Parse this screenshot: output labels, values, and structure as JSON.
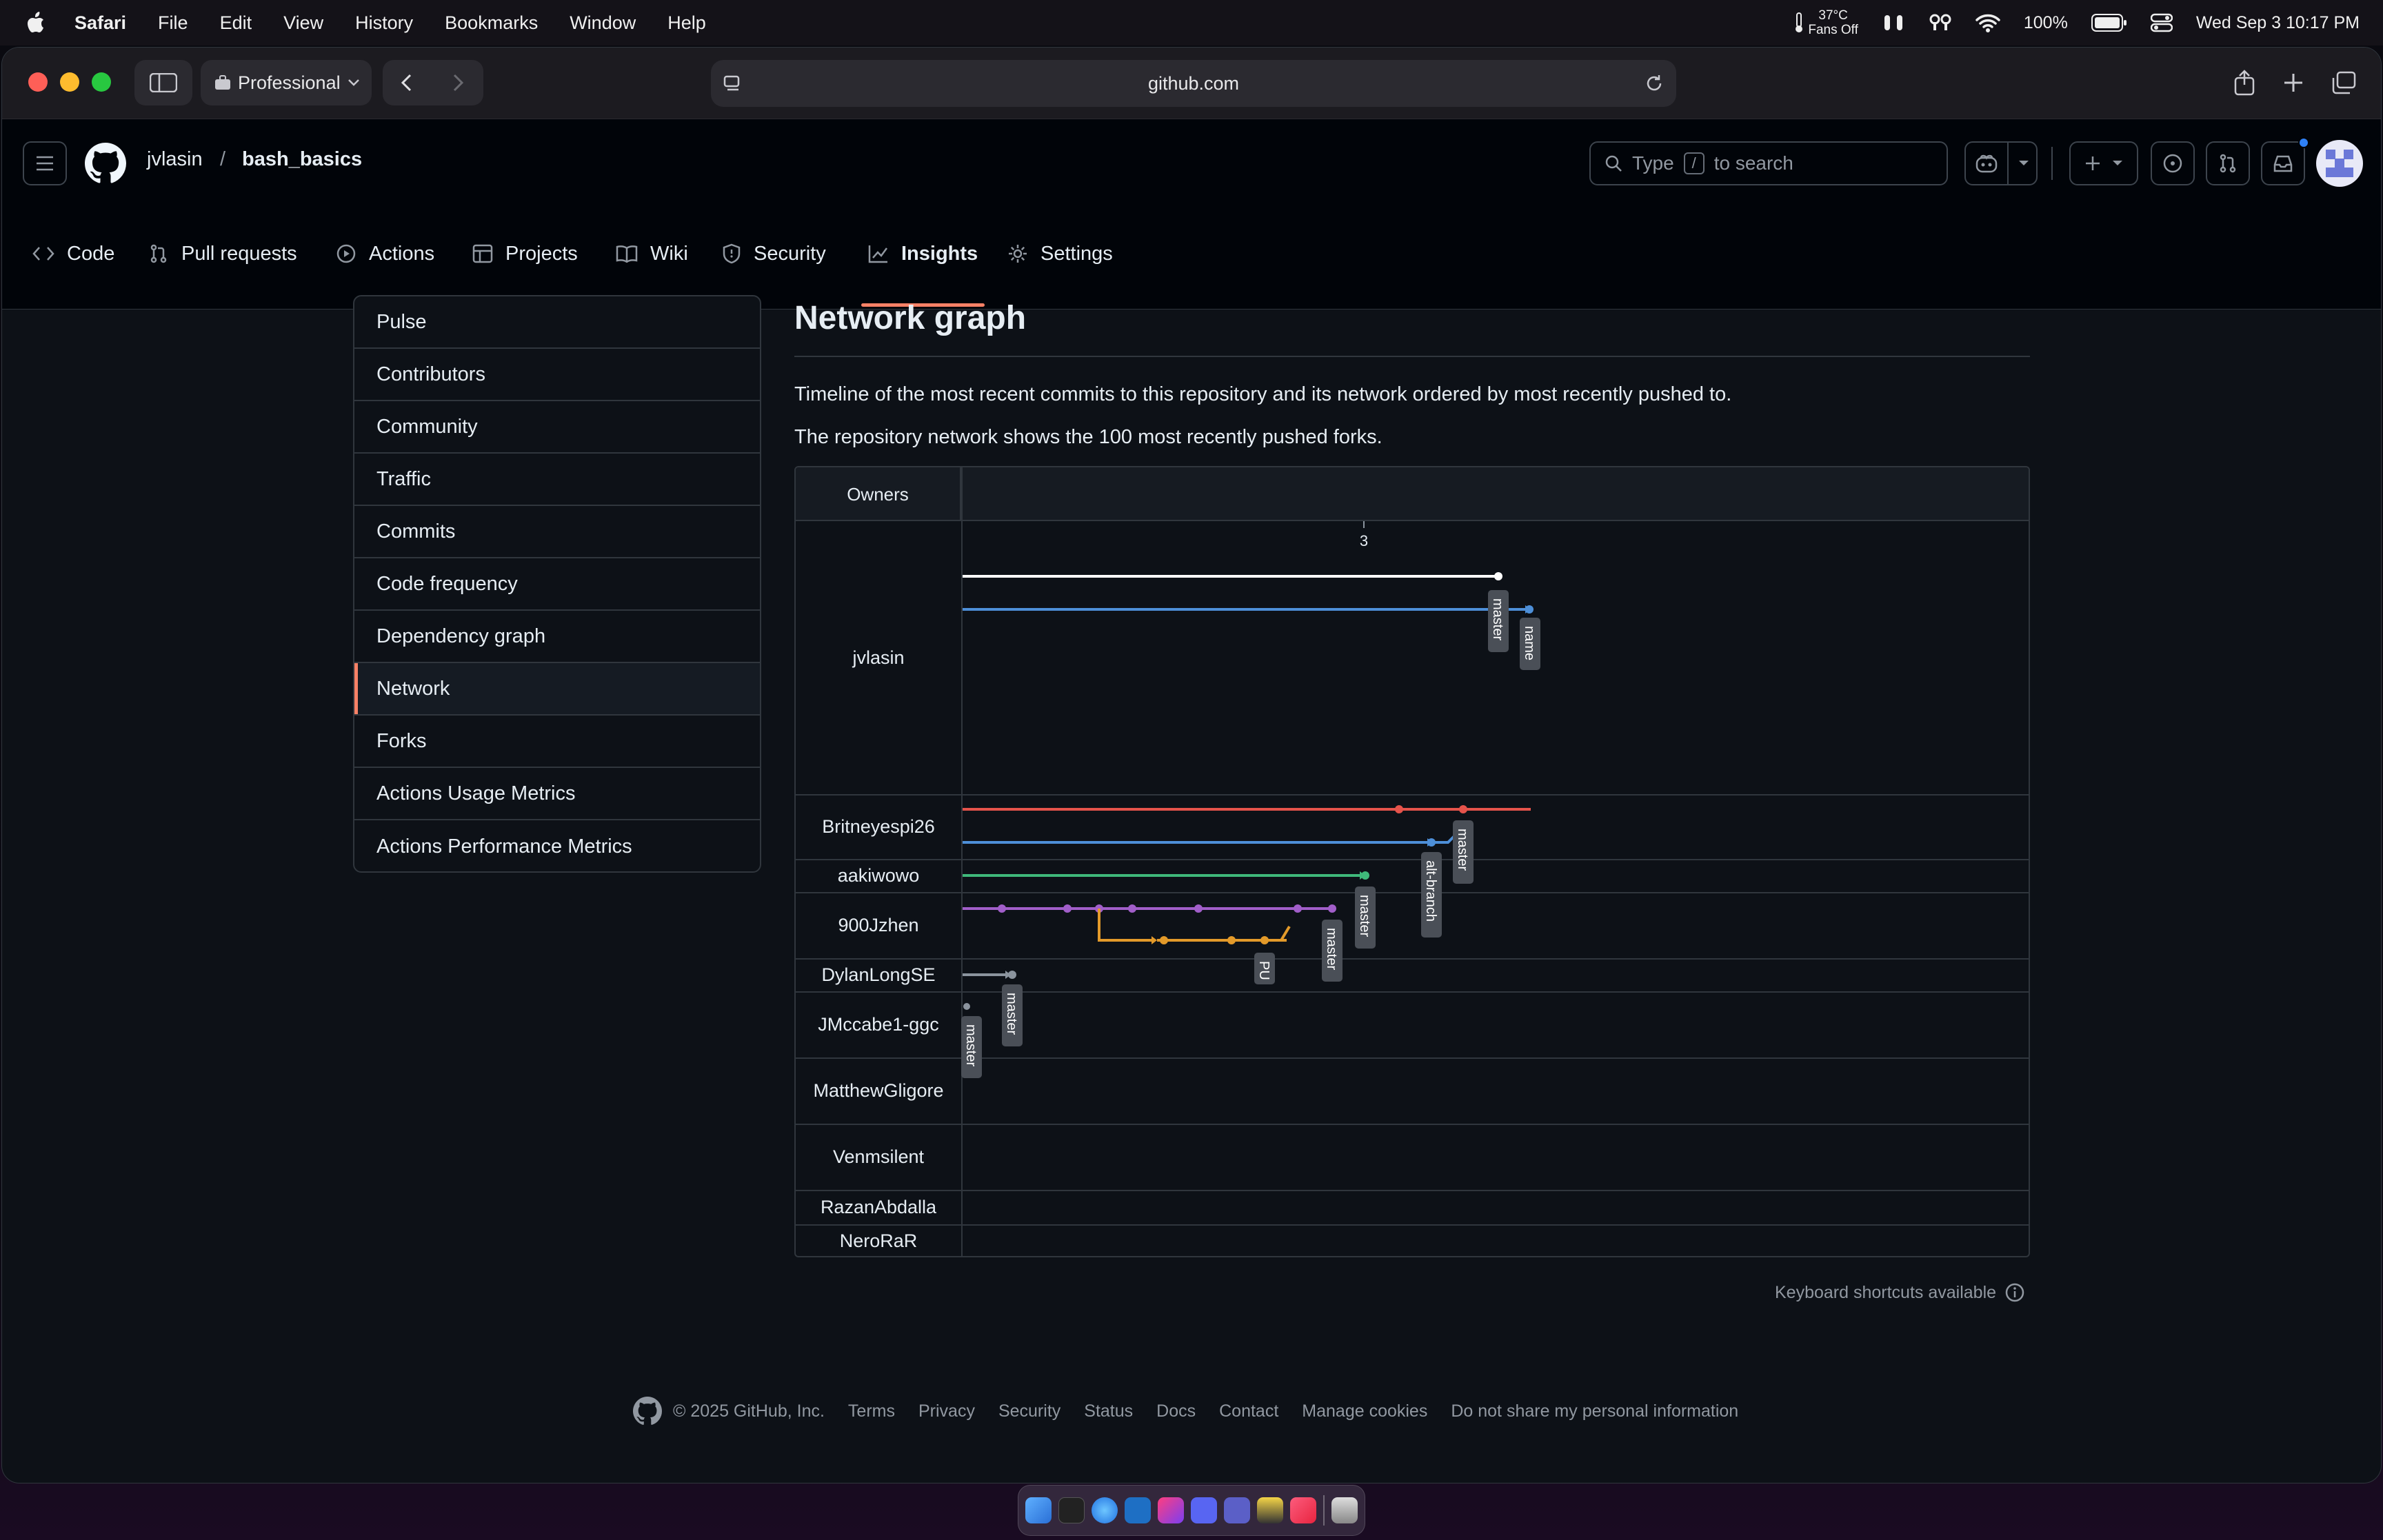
{
  "menubar": {
    "app": "Safari",
    "items": [
      "File",
      "Edit",
      "View",
      "History",
      "Bookmarks",
      "Window",
      "Help"
    ],
    "temp": "37°C",
    "fans": "Fans Off",
    "battery": "100%",
    "datetime": "Wed Sep 3  10:17 PM"
  },
  "browser": {
    "profile": "Professional",
    "url": "github.com"
  },
  "header": {
    "owner": "jvlasin",
    "separator": "/",
    "repo": "bash_basics",
    "search_prefix": "Type",
    "search_key": "/",
    "search_suffix": "to search"
  },
  "tabs": [
    "Code",
    "Pull requests",
    "Actions",
    "Projects",
    "Wiki",
    "Security",
    "Insights",
    "Settings"
  ],
  "sidebar": [
    "Pulse",
    "Contributors",
    "Community",
    "Traffic",
    "Commits",
    "Code frequency",
    "Dependency graph",
    "Network",
    "Forks",
    "Actions Usage Metrics",
    "Actions Performance Metrics"
  ],
  "main": {
    "title": "Network graph",
    "desc1": "Timeline of the most recent commits to this repository and its network ordered by most recently pushed to.",
    "desc2": "The repository network shows the 100 most recently pushed forks."
  },
  "graph": {
    "owners_header": "Owners",
    "date_label": "3",
    "owners": [
      "jvlasin",
      "Britneyespi26",
      "aakiwowo",
      "900Jzhen",
      "DylanLongSE",
      "JMccabe1-ggc",
      "MatthewGligore",
      "Venmsilent",
      "RazanAbdalla",
      "NeroRaR"
    ],
    "branch_labels": [
      "master",
      "name",
      "master",
      "alt-branch",
      "master",
      "master",
      "PU",
      "master",
      "master"
    ],
    "colors": {
      "white": "#ffffff",
      "blue": "#4d8fd8",
      "red": "#e5534b",
      "green": "#3fb97a",
      "purple": "#a15ec9",
      "orange": "#e39a2a",
      "gray": "#8b949e"
    }
  },
  "hint": "Keyboard shortcuts available",
  "footer": {
    "copyright": "© 2025 GitHub, Inc.",
    "links": [
      "Terms",
      "Privacy",
      "Security",
      "Status",
      "Docs",
      "Contact",
      "Manage cookies",
      "Do not share my personal information"
    ]
  }
}
